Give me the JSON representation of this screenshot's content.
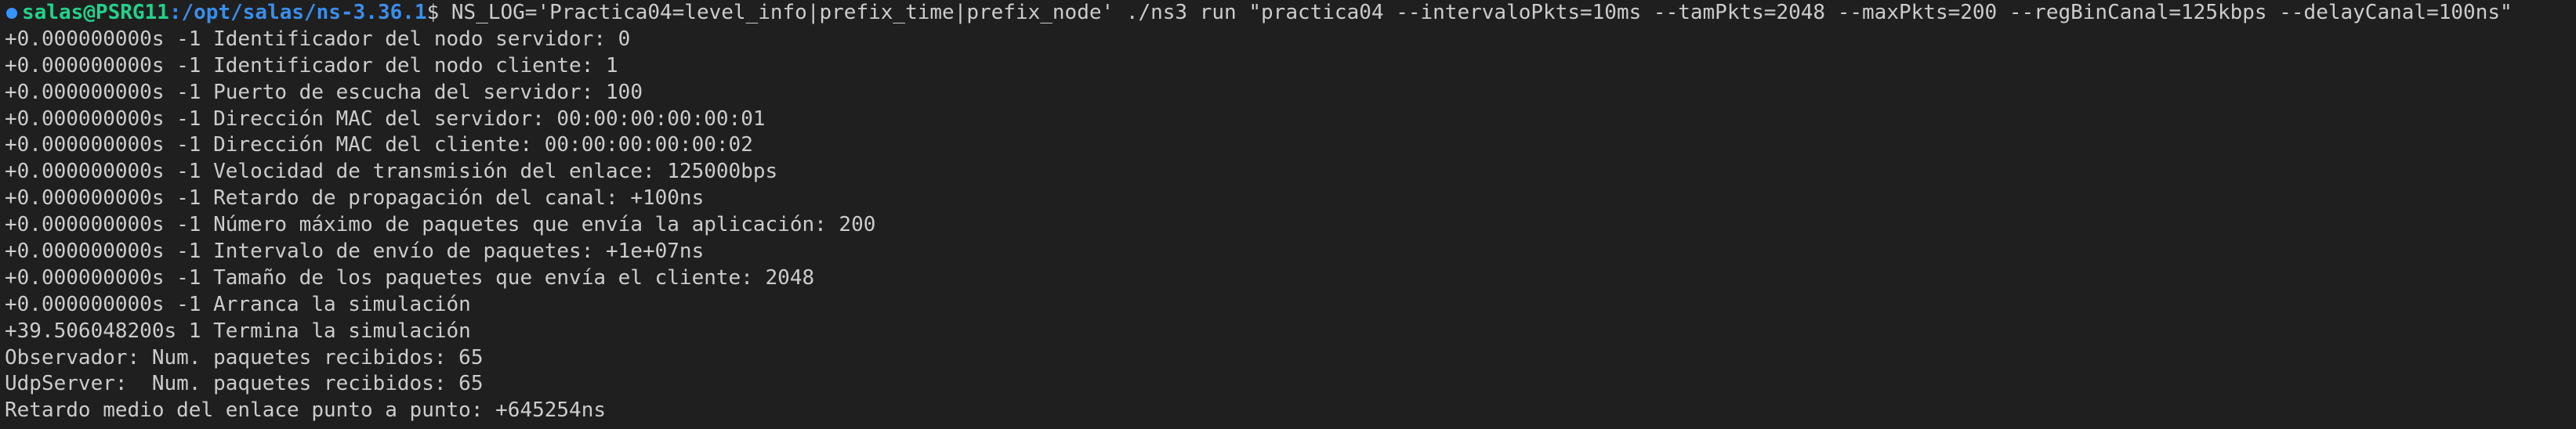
{
  "prompt": {
    "user_host": "salas@PSRG11",
    "path": ":/opt/salas/ns-3.36.1",
    "symbol": "$ ",
    "command": "NS_LOG='Practica04=level_info|prefix_time|prefix_node' ./ns3 run \"practica04 --intervaloPkts=10ms --tamPkts=2048 --maxPkts=200 --regBinCanal=125kbps --delayCanal=100ns\""
  },
  "colors": {
    "background": "#1f1f1f",
    "text": "#cccccc",
    "user_host": "#23d18b",
    "path": "#3b8eea",
    "status_dot": "#3794ff"
  },
  "output_lines": [
    "+0.000000000s -1 Identificador del nodo servidor: 0",
    "+0.000000000s -1 Identificador del nodo cliente: 1",
    "+0.000000000s -1 Puerto de escucha del servidor: 100",
    "+0.000000000s -1 Dirección MAC del servidor: 00:00:00:00:00:01",
    "+0.000000000s -1 Dirección MAC del cliente: 00:00:00:00:00:02",
    "+0.000000000s -1 Velocidad de transmisión del enlace: 125000bps",
    "+0.000000000s -1 Retardo de propagación del canal: +100ns",
    "+0.000000000s -1 Número máximo de paquetes que envía la aplicación: 200",
    "+0.000000000s -1 Intervalo de envío de paquetes: +1e+07ns",
    "+0.000000000s -1 Tamaño de los paquetes que envía el cliente: 2048",
    "+0.000000000s -1 Arranca la simulación",
    "+39.506048200s 1 Termina la simulación",
    "Observador: Num. paquetes recibidos: 65",
    "UdpServer:  Num. paquetes recibidos: 65",
    "Retardo medio del enlace punto a punto: +645254ns"
  ]
}
